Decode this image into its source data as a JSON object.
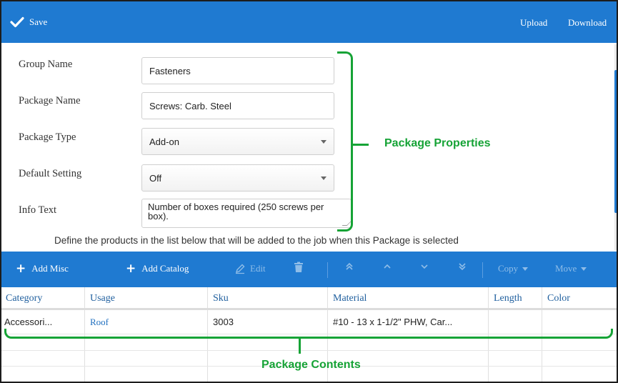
{
  "toolbar": {
    "save_label": "Save",
    "upload_label": "Upload",
    "download_label": "Download"
  },
  "form": {
    "group_name": {
      "label": "Group Name",
      "value": "Fasteners"
    },
    "package_name": {
      "label": "Package Name",
      "value": "Screws: Carb. Steel"
    },
    "package_type": {
      "label": "Package Type",
      "value": "Add-on"
    },
    "default_setting": {
      "label": "Default Setting",
      "value": "Off"
    },
    "info_text": {
      "label": "Info Text",
      "value": "Number of boxes required (250 screws per box)."
    },
    "define_text": "Define the products in the list below that will be added to the job when this Package is selected"
  },
  "annotations": {
    "properties": "Package Properties",
    "contents": "Package Contents"
  },
  "grid_toolbar": {
    "add_misc": "Add Misc",
    "add_catalog": "Add Catalog",
    "edit": "Edit",
    "copy": "Copy",
    "move": "Move"
  },
  "grid": {
    "columns": [
      "Category",
      "Usage",
      "Sku",
      "Material",
      "Length",
      "Color"
    ],
    "rows": [
      {
        "category": "Accessori...",
        "usage": "Roof",
        "sku": "3003",
        "material": "#10 - 13 x 1-1/2\" PHW, Car...",
        "length": "",
        "color": ""
      }
    ]
  },
  "colors": {
    "toolbar_blue": "#1f7ad1",
    "annotation_green": "#16a336",
    "header_text": "#1f5f9e"
  }
}
